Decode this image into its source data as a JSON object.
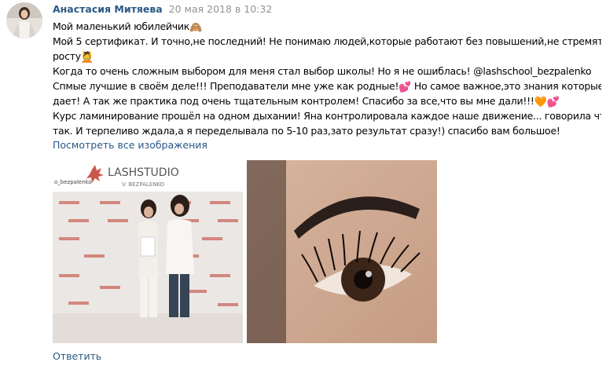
{
  "post": {
    "author": "Анастасия Митяева",
    "date": "20 мая 2018 в 10:32",
    "lines": [
      {
        "text": "Мой маленький юбилейчик",
        "emoji": "🙈"
      },
      {
        "text": "Мой 5 сертификат. И точно,не последний! Не понимаю людей,которые работают без повышений,не стремятся к",
        "emoji": ""
      },
      {
        "text": "росту",
        "emoji": "💆"
      },
      {
        "text": "Когда то очень сложным выбором для меня стал выбор школы! Но я не ошиблась! @lashschool_bezpalenko",
        "emoji": ""
      },
      {
        "text": "Спмые лучшие в своём деле!!! Преподаватели мне уже как родные!",
        "emoji": "💕",
        "tail": " Но самое важное,это знания которые они"
      },
      {
        "text": "дает! А так же практика под очень тщательным контролем! Спасибо за все,что вы мне дали!!!",
        "emoji": "🧡💕"
      },
      {
        "text": "Курс ламинирование прошёл на одном дыхании! Яна контролировала каждое наше движение... говорила что не",
        "emoji": ""
      },
      {
        "text": "так. И терпеливо ждала,а я переделывала по 5-10 раз,зато результат сразу!) спасибо вам большое!",
        "emoji": ""
      }
    ],
    "view_all_label": "Посмотреть все изображения",
    "reply_label": "Ответить",
    "images": [
      {
        "name": "certificate-photo",
        "banner_logo": "LASHSTUDIO",
        "banner_sub": "V. BEZPALENKO",
        "banner_handle": "o_bezpalenko"
      },
      {
        "name": "eyelash-closeup-photo"
      }
    ]
  },
  "colors": {
    "link": "#2a5885",
    "muted": "#939393",
    "text": "#000000",
    "logo_red": "#c0392b"
  }
}
